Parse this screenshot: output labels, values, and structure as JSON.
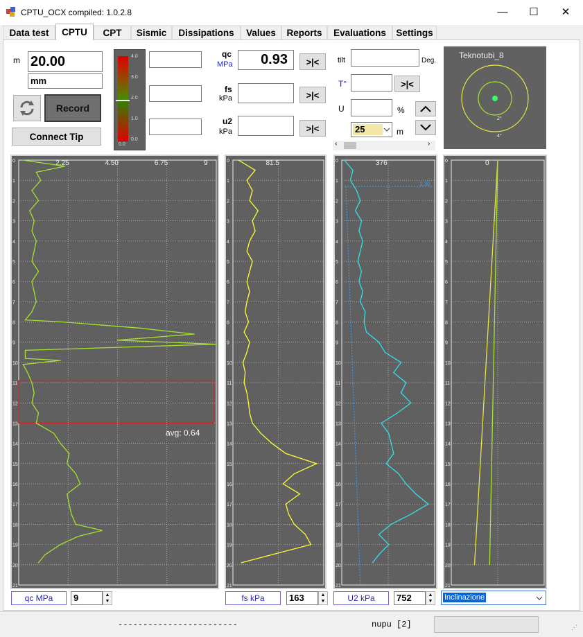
{
  "window": {
    "title": "CPTU_OCX  compiled: 1.0.2.8",
    "minimize": "—",
    "maximize": "☐",
    "close": "✕"
  },
  "tabs": [
    "Data test",
    "CPTU",
    "CPT",
    "Sismic",
    "Dissipations",
    "Values",
    "Reports",
    "Evaluations",
    "Settings"
  ],
  "active_tab": "CPTU",
  "left_panel": {
    "depth_unit_label": "m",
    "depth_value": "20.00",
    "unit_value": "mm",
    "record_label": "Record",
    "connect_label": "Connect Tip"
  },
  "gauge": {
    "ticks": [
      "4.0",
      "3.0",
      "2.0",
      "1.0",
      "0.0"
    ],
    "left_value": "0.0"
  },
  "readings": [
    {
      "name": "qc",
      "unit": "MPa",
      "value": "0.93",
      "button": ">|<"
    },
    {
      "name": "fs",
      "unit": "kPa",
      "value": "",
      "button": ">|<"
    },
    {
      "name": "u2",
      "unit": "kPa",
      "value": "",
      "button": ">|<"
    }
  ],
  "right_controls": {
    "tilt_label": "tilt",
    "tilt_unit": "Deg.",
    "temp_label": "T°",
    "temp_button": ">|<",
    "u_label": "U",
    "u_unit": "%",
    "step_value": "25",
    "step_unit": "m"
  },
  "inclinometer": {
    "title": "Teknotubi_8",
    "ring1": "2°",
    "ring2": "4°"
  },
  "chart_data": [
    {
      "type": "line",
      "name": "qc",
      "x_ticks": [
        "2.25",
        "4.50",
        "6.75",
        "9"
      ],
      "xlim": [
        0,
        9
      ],
      "y_ticks": [
        "0",
        "1",
        "2",
        "3",
        "4",
        "5",
        "6",
        "7",
        "8",
        "9",
        "10",
        "11",
        "12",
        "13",
        "14",
        "15",
        "16",
        "17",
        "18",
        "19",
        "20",
        "21"
      ],
      "ylim": [
        0,
        21
      ],
      "color": "#a6e22e",
      "depth": [
        0,
        0.3,
        0.6,
        1,
        1.5,
        2,
        2.5,
        3,
        3.5,
        4,
        4.5,
        5,
        5.5,
        6,
        6.5,
        7,
        7.5,
        7.9,
        8.0,
        8.3,
        8.6,
        8.9,
        9.1,
        9.4,
        9.8,
        9.9,
        10.1,
        10.5,
        11,
        11.5,
        12,
        12.5,
        13,
        13.5,
        14,
        14.5,
        15,
        15.5,
        16,
        16.5,
        17,
        17.5,
        18,
        18.3,
        18.6,
        19,
        19.5,
        19.9
      ],
      "values": [
        0.2,
        2.1,
        0.8,
        1.0,
        0.6,
        0.9,
        0.5,
        0.7,
        0.6,
        0.8,
        0.7,
        0.6,
        0.9,
        0.6,
        0.7,
        0.8,
        0.6,
        0.3,
        2.0,
        5.5,
        8.0,
        4.5,
        9.0,
        0.3,
        0.3,
        1.9,
        0.2,
        0.4,
        0.6,
        0.7,
        0.6,
        0.9,
        0.8,
        1.6,
        1.9,
        2.3,
        2.2,
        2.6,
        2.8,
        2.2,
        2.3,
        2.4,
        2.6,
        3.8,
        2.7,
        1.9,
        1.2,
        0.9
      ],
      "annotation": "avg: 0.64",
      "band": [
        10.9,
        13.0
      ],
      "footer_unit": "qc  MPa",
      "footer_value": "9"
    },
    {
      "type": "line",
      "name": "fs",
      "x_ticks": [
        "81.5"
      ],
      "xlim": [
        0,
        163
      ],
      "y_ticks": [
        "0",
        "1",
        "2",
        "3",
        "4",
        "5",
        "6",
        "7",
        "8",
        "9",
        "10",
        "11",
        "12",
        "13",
        "14",
        "15",
        "16",
        "17",
        "18",
        "19",
        "20",
        "21"
      ],
      "ylim": [
        0,
        21
      ],
      "color": "#ffff33",
      "depth": [
        0,
        0.5,
        1,
        1.5,
        2,
        2.5,
        3,
        3.5,
        4,
        4.5,
        5,
        5.5,
        6,
        6.5,
        7,
        7.5,
        8,
        8.5,
        9,
        9.5,
        10,
        10.5,
        11,
        11.5,
        12,
        12.5,
        13,
        13.5,
        14,
        14.5,
        15,
        15.5,
        16,
        16.5,
        17,
        17.5,
        18,
        18.5,
        19,
        19.5,
        19.9
      ],
      "values": [
        10,
        40,
        25,
        35,
        30,
        45,
        35,
        40,
        30,
        25,
        35,
        30,
        25,
        30,
        25,
        22,
        28,
        20,
        30,
        25,
        18,
        22,
        20,
        25,
        28,
        30,
        35,
        50,
        70,
        95,
        150,
        110,
        90,
        120,
        95,
        100,
        110,
        130,
        140,
        70,
        15
      ],
      "footer_unit": "fs  kPa",
      "footer_value": "163"
    },
    {
      "type": "line",
      "name": "u2",
      "x_ticks": [
        "0",
        "376"
      ],
      "xlim": [
        0,
        752
      ],
      "y_ticks": [
        "0",
        "1",
        "2",
        "3",
        "4",
        "5",
        "6",
        "7",
        "8",
        "9",
        "10",
        "11",
        "12",
        "13",
        "14",
        "15",
        "16",
        "17",
        "18",
        "19",
        "20",
        "21"
      ],
      "ylim": [
        0,
        21
      ],
      "color": "#33e0e8",
      "depth": [
        0,
        0.5,
        1,
        1.5,
        2,
        2.5,
        3,
        3.5,
        4,
        4.5,
        5,
        5.5,
        6,
        6.5,
        7,
        7.5,
        8,
        8.5,
        9,
        9.5,
        10,
        10.5,
        11,
        11.5,
        12,
        12.5,
        13,
        13.5,
        14,
        14.5,
        15,
        15.5,
        16,
        16.5,
        17,
        17.5,
        18,
        18.5,
        19,
        19.5,
        19.9
      ],
      "values": [
        20,
        90,
        70,
        120,
        150,
        110,
        160,
        140,
        170,
        150,
        130,
        160,
        140,
        170,
        150,
        190,
        180,
        200,
        300,
        350,
        480,
        420,
        520,
        480,
        560,
        450,
        320,
        380,
        400,
        420,
        360,
        460,
        520,
        600,
        700,
        560,
        400,
        300,
        380,
        300,
        250
      ],
      "hydro_label": "1.30",
      "hydro_depth": 1.3,
      "footer_unit": "U2  kPa",
      "footer_value": "752"
    },
    {
      "type": "line",
      "name": "inclination",
      "x_ticks": [
        "0"
      ],
      "xlim": [
        -4,
        4
      ],
      "y_ticks": [
        "0",
        "1",
        "2",
        "3",
        "4",
        "5",
        "6",
        "7",
        "8",
        "9",
        "10",
        "11",
        "12",
        "13",
        "14",
        "15",
        "16",
        "17",
        "18",
        "19",
        "20",
        "21"
      ],
      "ylim": [
        0,
        21
      ],
      "series": [
        {
          "color": "#e6e640",
          "depth": [
            0,
            20
          ],
          "values": [
            0,
            -2.0
          ]
        },
        {
          "color": "#a6e22e",
          "depth": [
            0,
            20
          ],
          "values": [
            0,
            -0.7
          ]
        }
      ],
      "footer_select": "Inclinazione"
    }
  ],
  "status": {
    "dashes": "------------------------",
    "message": "nupu [2]"
  }
}
